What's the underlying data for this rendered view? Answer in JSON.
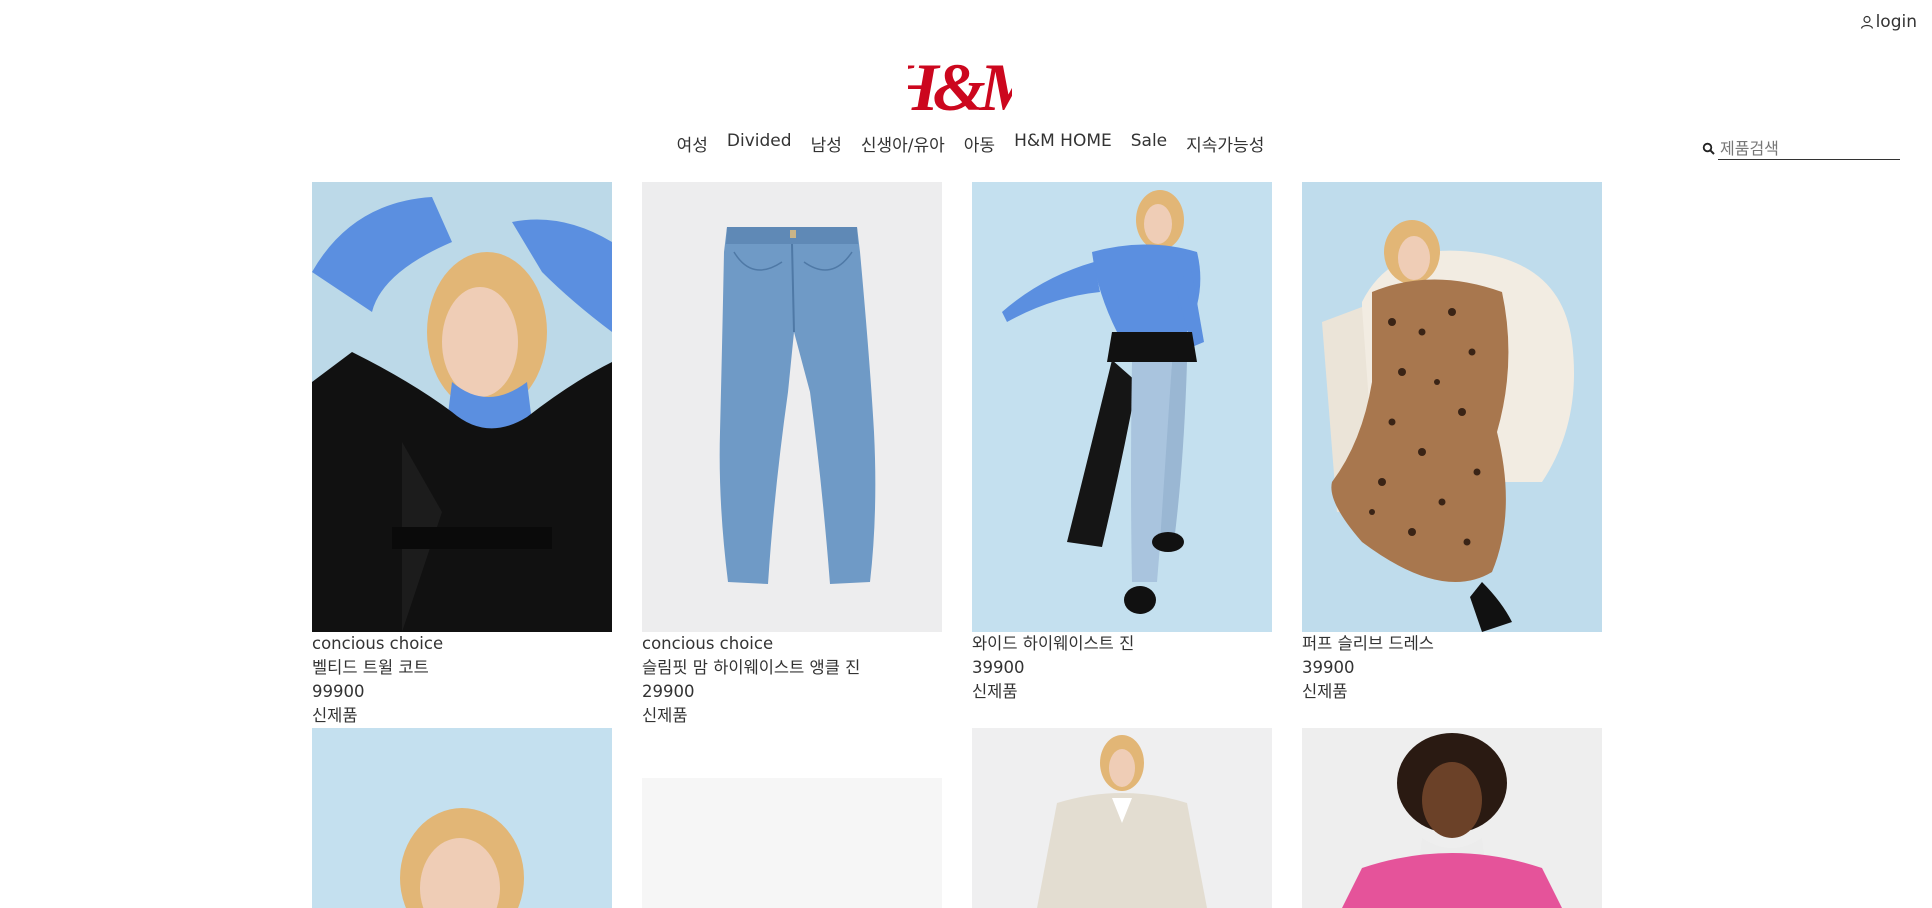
{
  "header": {
    "login_label": "login",
    "logo_text": "H&M",
    "brand_color": "#cc071e"
  },
  "nav": {
    "items": [
      "여성",
      "Divided",
      "남성",
      "신생아/유아",
      "아동",
      "H&M HOME",
      "Sale",
      "지속가능성"
    ]
  },
  "search": {
    "placeholder": "제품검색",
    "value": ""
  },
  "products": [
    {
      "tag": "concious choice",
      "title": "벨티드 트윌 코트",
      "price": "99900",
      "badge": "신제품"
    },
    {
      "tag": "concious choice",
      "title": "슬림핏 맘 하이웨이스트 앵클 진",
      "price": "29900",
      "badge": "신제품"
    },
    {
      "tag": "",
      "title": "와이드 하이웨이스트 진",
      "price": "39900",
      "badge": "신제품"
    },
    {
      "tag": "",
      "title": "퍼프 슬리브 드레스",
      "price": "39900",
      "badge": "신제품"
    }
  ]
}
